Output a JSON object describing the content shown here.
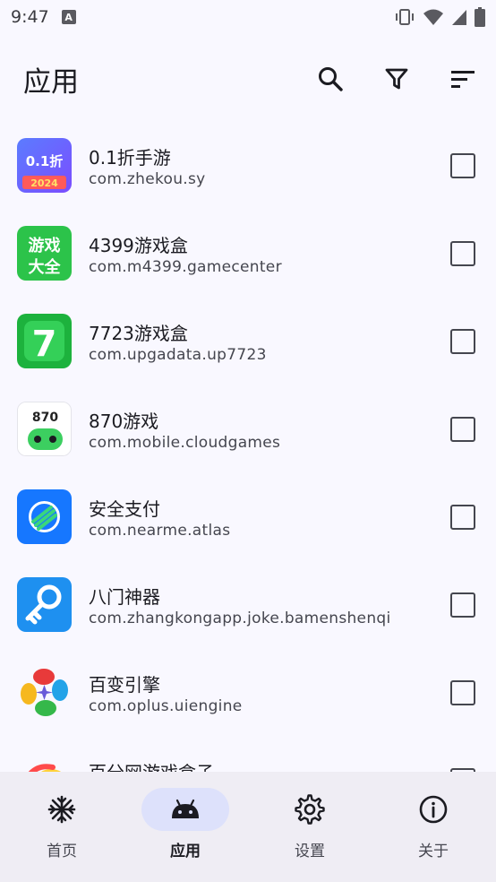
{
  "status_bar": {
    "time": "9:47",
    "notification_icon": "A"
  },
  "app_bar": {
    "title": "应用",
    "actions": [
      "search-icon",
      "filter-icon",
      "sort-icon"
    ]
  },
  "apps": [
    {
      "name": "0.1折手游",
      "package": "com.zhekou.sy",
      "icon": "zhekou-app-icon",
      "icon_text": "0.1折",
      "icon_caption": "2024",
      "checked": false
    },
    {
      "name": "4399游戏盒",
      "package": "com.m4399.gamecenter",
      "icon": "game4399-app-icon",
      "icon_text": "游戏大全",
      "checked": false
    },
    {
      "name": "7723游戏盒",
      "package": "com.upgadata.up7723",
      "icon": "game7723-app-icon",
      "icon_text": "7",
      "checked": false
    },
    {
      "name": "870游戏",
      "package": "com.mobile.cloudgames",
      "icon": "game870-app-icon",
      "icon_text": "870",
      "checked": false
    },
    {
      "name": "安全支付",
      "package": "com.nearme.atlas",
      "icon": "secure-pay-app-icon",
      "checked": false
    },
    {
      "name": "八门神器",
      "package": "com.zhangkongapp.joke.bamenshenqi",
      "icon": "bamen-app-icon",
      "checked": false
    },
    {
      "name": "百变引擎",
      "package": "com.oplus.uiengine",
      "icon": "uiengine-app-icon",
      "checked": false
    },
    {
      "name": "百分网游戏盒子",
      "package": "",
      "icon": "baifen-app-icon",
      "checked": false
    }
  ],
  "bottom_nav": {
    "items": [
      {
        "label": "首页",
        "icon": "snowflake-icon",
        "active": false
      },
      {
        "label": "应用",
        "icon": "android-icon",
        "active": true
      },
      {
        "label": "设置",
        "icon": "gear-icon",
        "active": false
      },
      {
        "label": "关于",
        "icon": "info-icon",
        "active": false
      }
    ]
  },
  "colors": {
    "background": "#f9f8ff",
    "nav_background": "#efedf4",
    "active_pill": "#dde1fb",
    "text": "#1b1b21",
    "secondary_text": "#45464f"
  }
}
